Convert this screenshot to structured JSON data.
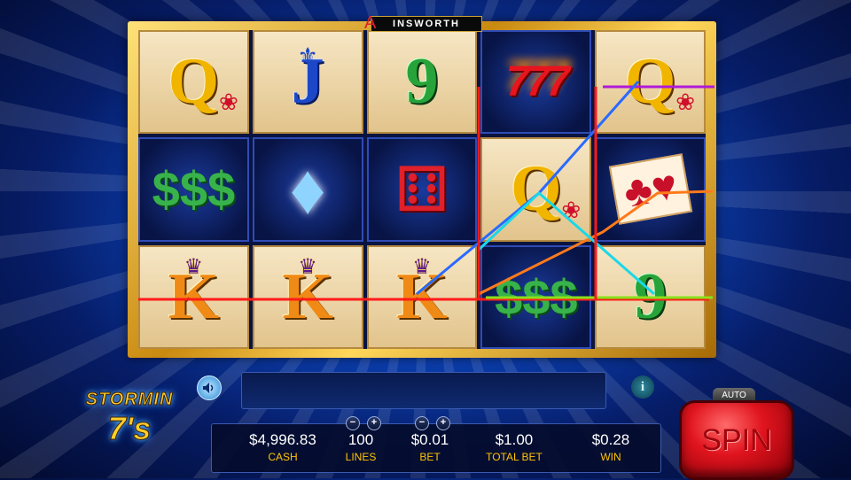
{
  "brand": {
    "name": "INSWORTH",
    "mark": "A"
  },
  "reels": [
    [
      {
        "kind": "card",
        "letter": "Q",
        "color": "gold",
        "icon": "rose",
        "bg": "light"
      },
      {
        "kind": "cash",
        "glyph": "$$$",
        "bg": "dark"
      },
      {
        "kind": "card",
        "letter": "K",
        "color": "orange",
        "icon": "crown",
        "bg": "light"
      }
    ],
    [
      {
        "kind": "card",
        "letter": "J",
        "color": "blue",
        "icon": "fleur",
        "bg": "light"
      },
      {
        "kind": "diamond",
        "glyph": "♦",
        "bg": "dark"
      },
      {
        "kind": "card",
        "letter": "K",
        "color": "orange",
        "icon": "crown",
        "bg": "light"
      }
    ],
    [
      {
        "kind": "card",
        "letter": "9",
        "color": "green",
        "icon": "",
        "bg": "light"
      },
      {
        "kind": "dice",
        "glyph": "⚅",
        "bg": "dark"
      },
      {
        "kind": "card",
        "letter": "K",
        "color": "orange",
        "icon": "crown",
        "bg": "light"
      }
    ],
    [
      {
        "kind": "sevens",
        "glyph": "777",
        "bg": "dark"
      },
      {
        "kind": "card",
        "letter": "Q",
        "color": "gold",
        "icon": "rose",
        "bg": "light"
      },
      {
        "kind": "cash",
        "glyph": "$$$",
        "bg": "dark"
      }
    ],
    [
      {
        "kind": "card",
        "letter": "Q",
        "color": "gold",
        "icon": "rose",
        "bg": "light"
      },
      {
        "kind": "cards",
        "glyph": "♣♥",
        "bg": "dark"
      },
      {
        "kind": "card",
        "letter": "9",
        "color": "green",
        "icon": "",
        "bg": "light"
      }
    ]
  ],
  "paylines": [
    {
      "color": "#ff1a1a"
    },
    {
      "color": "#b01ad8"
    },
    {
      "color": "#2a6aff"
    },
    {
      "color": "#ff7a1a"
    },
    {
      "color": "#1ad8e8"
    },
    {
      "color": "#8ae01a"
    }
  ],
  "logo": {
    "top": "STORMIN",
    "bottom": "7's"
  },
  "controls": {
    "sound_icon": "speaker-icon",
    "info_glyph": "i",
    "stats": [
      {
        "value": "$4,996.83",
        "label": "CASH"
      },
      {
        "value": "100",
        "label": "LINES"
      },
      {
        "value": "$0.01",
        "label": "BET"
      },
      {
        "value": "$1.00",
        "label": "TOTAL BET"
      },
      {
        "value": "$0.28",
        "label": "WIN"
      }
    ],
    "minus": "−",
    "plus": "+",
    "auto_label": "AUTO",
    "spin_label": "SPIN"
  }
}
